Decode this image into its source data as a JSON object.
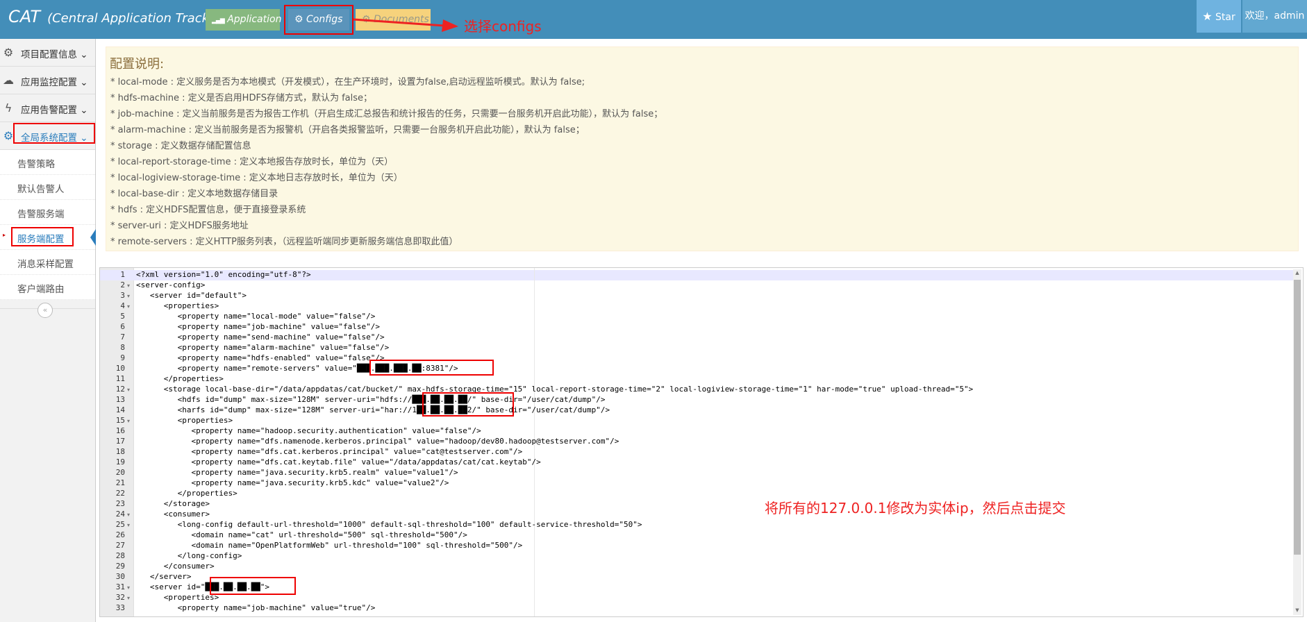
{
  "header": {
    "brand": "CAT",
    "brand_sub": "(Central Application Tracking)",
    "nav": {
      "application": "Application",
      "configs": "Configs",
      "documents": "Documents"
    },
    "star": "Star",
    "welcome": "欢迎，admin"
  },
  "sidebar": {
    "menus": [
      "项目配置信息",
      "应用监控配置",
      "应用告警配置",
      "全局系统配置"
    ],
    "submenu": [
      "告警策略",
      "默认告警人",
      "告警服务端",
      "服务端配置",
      "消息采样配置",
      "客户端路由"
    ],
    "active_item": "服务端配置"
  },
  "alert": {
    "title": "配置说明:",
    "lines": [
      "* local-mode : 定义服务是否为本地模式（开发模式），在生产环境时，设置为false,启动远程监听模式。默认为 false;",
      "* hdfs-machine : 定义是否启用HDFS存储方式，默认为 false；",
      "* job-machine : 定义当前服务是否为报告工作机（开启生成汇总报告和统计报告的任务，只需要一台服务机开启此功能），默认为 false；",
      "* alarm-machine : 定义当前服务是否为报警机（开启各类报警监听，只需要一台服务机开启此功能），默认为 false；",
      "* storage : 定义数据存储配置信息",
      "* local-report-storage-time : 定义本地报告存放时长，单位为（天）",
      "* local-logiview-storage-time : 定义本地日志存放时长，单位为（天）",
      "* local-base-dir : 定义本地数据存储目录",
      "* hdfs : 定义HDFS配置信息，便于直接登录系统",
      "* server-uri : 定义HDFS服务地址",
      "* remote-servers : 定义HTTP服务列表，（远程监听端同步更新服务端信息即取此值）"
    ]
  },
  "editor": {
    "line_numbers": [
      "1",
      "2",
      "3",
      "4",
      "5",
      "6",
      "7",
      "8",
      "9",
      "10",
      "11",
      "12",
      "13",
      "14",
      "15",
      "16",
      "17",
      "18",
      "19",
      "20",
      "21",
      "22",
      "23",
      "24",
      "25",
      "26",
      "27",
      "28",
      "29",
      "30",
      "31",
      "32",
      "33"
    ],
    "lines": [
      "<?xml version=\"1.0\" encoding=\"utf-8\"?>",
      "<server-config>",
      "   <server id=\"default\">",
      "      <properties>",
      "         <property name=\"local-mode\" value=\"false\"/>",
      "         <property name=\"job-machine\" value=\"false\"/>",
      "         <property name=\"send-machine\" value=\"false\"/>",
      "         <property name=\"alarm-machine\" value=\"false\"/>",
      "         <property name=\"hdfs-enabled\" value=\"false\"/>",
      "         <property name=\"remote-servers\" value=\"███.███.███.██:8381\"/>",
      "      </properties>",
      "      <storage local-base-dir=\"/data/appdatas/cat/bucket/\" max-hdfs-storage-time=\"15\" local-report-storage-time=\"2\" local-logiview-storage-time=\"1\" har-mode=\"true\" upload-thread=\"5\">",
      "         <hdfs id=\"dump\" max-size=\"128M\" server-uri=\"hdfs://███.██.██.██/\" base-dir=\"/user/cat/dump\"/>",
      "         <harfs id=\"dump\" max-size=\"128M\" server-uri=\"har://1██.██.██.██2/\" base-dir=\"/user/cat/dump\"/>",
      "         <properties>",
      "            <property name=\"hadoop.security.authentication\" value=\"false\"/>",
      "            <property name=\"dfs.namenode.kerberos.principal\" value=\"hadoop/dev80.hadoop@testserver.com\"/>",
      "            <property name=\"dfs.cat.kerberos.principal\" value=\"cat@testserver.com\"/>",
      "            <property name=\"dfs.cat.keytab.file\" value=\"/data/appdatas/cat/cat.keytab\"/>",
      "            <property name=\"java.security.krb5.realm\" value=\"value1\"/>",
      "            <property name=\"java.security.krb5.kdc\" value=\"value2\"/>",
      "         </properties>",
      "      </storage>",
      "      <consumer>",
      "         <long-config default-url-threshold=\"1000\" default-sql-threshold=\"100\" default-service-threshold=\"50\">",
      "            <domain name=\"cat\" url-threshold=\"500\" sql-threshold=\"500\"/>",
      "            <domain name=\"OpenPlatformWeb\" url-threshold=\"100\" sql-threshold=\"500\"/>",
      "         </long-config>",
      "      </consumer>",
      "   </server>",
      "   <server id=\"███.██.██.██\">",
      "      <properties>",
      "         <property name=\"job-machine\" value=\"true\"/>"
    ],
    "foldable_lines": [
      2,
      3,
      4,
      12,
      15,
      24,
      25,
      31,
      32
    ]
  },
  "annotations": {
    "select_configs": "选择configs",
    "modify_note": "将所有的127.0.0.1修改为实体ip，然后点击提交"
  },
  "colors": {
    "topbar": "#438eb9",
    "application_button": "#87b87f",
    "configs_button": "#5b94bb",
    "documents_button": "#f6d27c",
    "alert_bg": "#fcf8e3",
    "annotation_red": "#e00000"
  }
}
